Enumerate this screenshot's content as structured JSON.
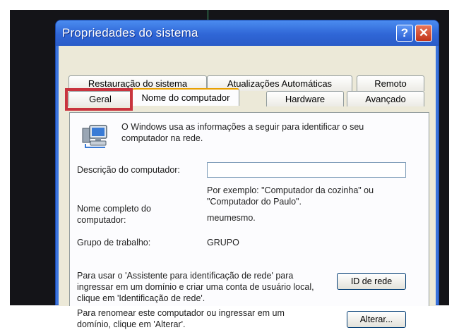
{
  "window": {
    "title": "Propriedades do sistema",
    "help_glyph": "?",
    "close_glyph": "✕"
  },
  "tabs": {
    "row_back": [
      "Restauração do sistema",
      "Atualizações Automáticas",
      "Remoto"
    ],
    "row_front": [
      "Geral",
      "Nome do computador",
      "Hardware",
      "Avançado"
    ],
    "active": "Nome do computador",
    "highlighted": "Geral"
  },
  "content": {
    "intro": "O Windows usa as informações a seguir para identificar o seu computador na rede.",
    "description_label": "Descrição do computador:",
    "description_value": "",
    "example_text": "Por exemplo: \"Computador da cozinha\" ou \"Computador do Paulo\".",
    "full_name_label": "Nome completo do computador:",
    "full_name_value": "meumesmo.",
    "workgroup_label": "Grupo de trabalho:",
    "workgroup_value": "GRUPO",
    "network_id_text": "Para usar o 'Assistente para identificação de rede' para ingressar em um domínio e criar uma conta de usuário local, clique em 'Identificação de rede'.",
    "network_id_button": "ID de rede",
    "rename_text": "Para renomear este computador ou ingressar em um domínio, clique em 'Alterar'.",
    "change_button": "Alterar..."
  },
  "colors": {
    "titlebar": "#2f66d6",
    "highlight_box": "#c8343e",
    "active_tab_accent": "#e8a000"
  },
  "icons": [
    "computer-network-icon",
    "help-icon",
    "close-icon"
  ]
}
